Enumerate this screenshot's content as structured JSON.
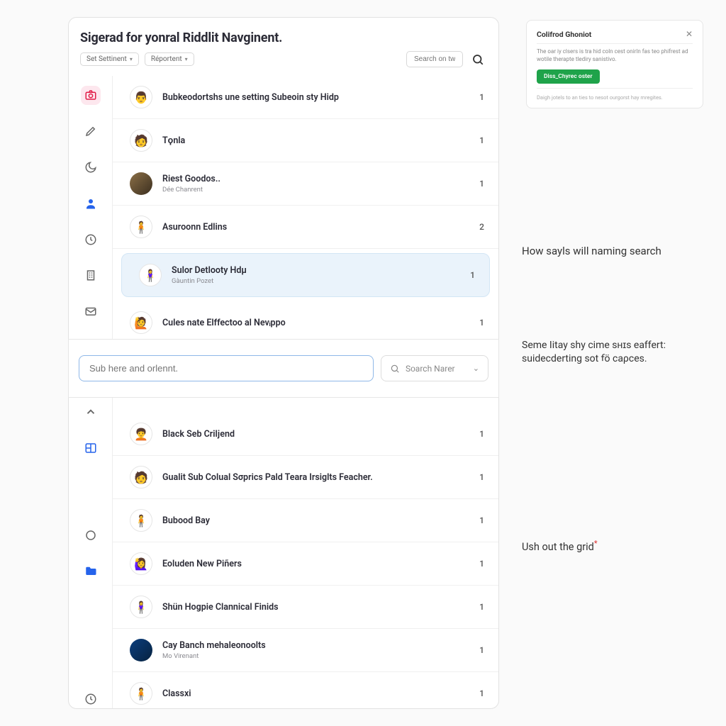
{
  "header": {
    "title": "Sigerad for yonral Riddlit Navginent.",
    "chip1": "Set Settinent",
    "chip2": "Réportent",
    "search_placeholder": "Search on tw"
  },
  "sidebar_icons": [
    {
      "name": "camera",
      "active": true
    },
    {
      "name": "edit"
    },
    {
      "name": "moon"
    },
    {
      "name": "user",
      "blue": true
    },
    {
      "name": "clock"
    },
    {
      "name": "building"
    },
    {
      "name": "mail"
    },
    {
      "name": "chevron-up"
    },
    {
      "name": "layout",
      "blue": true
    },
    {
      "name": "circle"
    },
    {
      "name": "folder",
      "blue": true
    },
    {
      "name": "clock2"
    }
  ],
  "rows": [
    {
      "emoji": "👨",
      "title": "Bubkeodortshs une setting Subeoin sty Hidp",
      "sub": "",
      "count": "1"
    },
    {
      "emoji": "🧑",
      "title": "Tϙnla",
      "sub": "",
      "count": "1"
    },
    {
      "photo": true,
      "title": "Riest Goodos..",
      "sub": "Dée Chanrent",
      "count": "1"
    },
    {
      "emoji": "🧍",
      "title": "Asuroonn Edlins",
      "sub": "",
      "count": "2"
    },
    {
      "emoji": "🧍‍♀️",
      "title": "Sulor Detlooty Hdμ",
      "sub": "Gàuntin Pozet",
      "count": "1",
      "selected": true
    },
    {
      "emoji": "🙋",
      "title": "Cules nate Elffectoo al Nevᵢppo",
      "sub": "",
      "count": "1"
    },
    {
      "emoji": "🧑‍🦱",
      "title": "Black Seb Crilϳend",
      "sub": "",
      "count": "1"
    },
    {
      "emoji": "🧑",
      "title": "Gualit Sub Colual Sσprics Pald Teara Irsiglts Feacher.",
      "sub": "",
      "count": "1"
    },
    {
      "emoji": "🧍",
      "title": "Bubood Bay",
      "sub": "",
      "count": "1"
    },
    {
      "emoji": "🙋‍♀️",
      "title": "Eoluden New Piñers",
      "sub": "",
      "count": "1"
    },
    {
      "emoji": "🧍‍♀️",
      "title": "Shün Hogpie Clannical Finids",
      "sub": "",
      "count": "1"
    },
    {
      "photo2": true,
      "title": "Cay Banch mehaleonoolts",
      "sub": "Mo Virenant",
      "count": "1"
    },
    {
      "emoji": "🧍",
      "title": "Classxi",
      "sub": "",
      "count": "1"
    }
  ],
  "mid_search": {
    "placeholder": "Sub here and orlennt.",
    "select_label": "Sᴏarch  Narer"
  },
  "info_card": {
    "title": "Colifrod Ghoniot",
    "desc": "The oar iy clsers is tra hid coln cest onirln fas teo phifrest ad wotile therapte tlediry sanistivo.",
    "button": "Diss_Chyrec oster",
    "footer": "Daigh jotels to an ties to nesot ourgorst hay mregites."
  },
  "notes": {
    "n1": "How sayls will naming search",
    "n2": "Seme Iitay shy cime sʜɪs eaffert: suidecderting sot ꬵö caρces.",
    "n3": "Ush out the grid"
  }
}
